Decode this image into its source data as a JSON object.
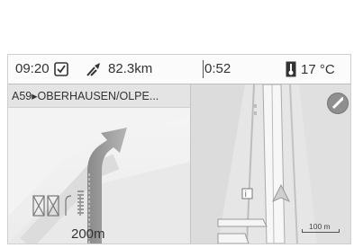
{
  "status_bar": {
    "time": "09:20",
    "distance": "82.3km",
    "duration": "0:52",
    "temperature": "17 °C",
    "icons": {
      "time": "clock-icon",
      "distance": "route-distance-icon",
      "temperature": "thermometer-icon"
    }
  },
  "guidance": {
    "route": "A59▸OBERHAUSEN/OLPE...",
    "next_maneuver_distance": "200m",
    "maneuver_icon": "turn-right-arrow-icon",
    "lane_icon": "lane-guidance-icon"
  },
  "map": {
    "scale": "100 m",
    "icons": {
      "compass": "compass-icon",
      "vehicle": "vehicle-position-icon",
      "poi": "poi-icon"
    }
  }
}
